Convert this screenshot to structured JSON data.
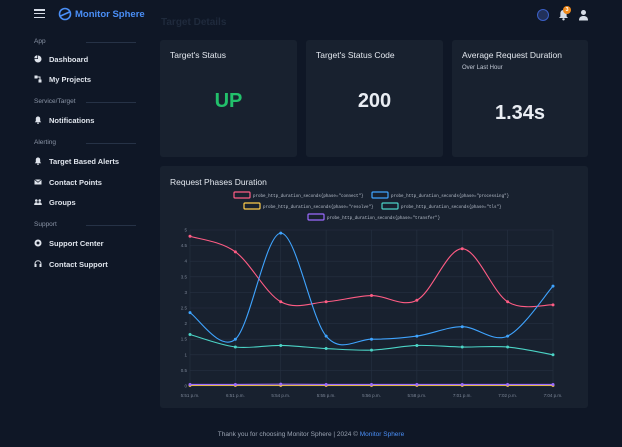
{
  "brand": {
    "name": "Monitor Sphere"
  },
  "header": {
    "notification_count": "3"
  },
  "page_title": "Target Details",
  "sidebar": {
    "sections": [
      {
        "label": "App",
        "items": [
          {
            "label": "Dashboard",
            "icon": "pie-chart-icon"
          },
          {
            "label": "My Projects",
            "icon": "projects-icon"
          }
        ]
      },
      {
        "label": "Service/Target",
        "items": [
          {
            "label": "Notifications",
            "icon": "bell-icon"
          }
        ]
      },
      {
        "label": "Alerting",
        "items": [
          {
            "label": "Target Based Alerts",
            "icon": "alert-bell-icon"
          },
          {
            "label": "Contact Points",
            "icon": "mail-icon"
          },
          {
            "label": "Groups",
            "icon": "users-icon"
          }
        ]
      },
      {
        "label": "Support",
        "items": [
          {
            "label": "Support Center",
            "icon": "support-icon"
          },
          {
            "label": "Contact Support",
            "icon": "headset-icon"
          }
        ]
      }
    ]
  },
  "cards": {
    "status": {
      "title": "Target's Status",
      "value": "UP",
      "color": "#22c06b"
    },
    "status_code": {
      "title": "Target's Status Code",
      "value": "200"
    },
    "avg_duration": {
      "title": "Average Request Duration",
      "subtitle": "Over Last Hour",
      "value": "1.34s"
    }
  },
  "chart": {
    "title": "Request Phases Duration"
  },
  "chart_data": {
    "type": "line",
    "x": [
      "5:51 p.m.",
      "6:51 p.m.",
      "5:54 p.m.",
      "5:55 p.m.",
      "5:56 p.m.",
      "5:58 p.m.",
      "7:01 p.m.",
      "7:02 p.m.",
      "7:04 p.m."
    ],
    "ylim": [
      0,
      5
    ],
    "yticks": [
      "0",
      "0.5",
      "1",
      "1.5",
      "2",
      "2.5",
      "3",
      "3.5",
      "4",
      "4.5",
      "5"
    ],
    "series": [
      {
        "name": "probe_http_duration_seconds{phase=\"connect\"}",
        "color": "#ff5c84",
        "values": [
          4.8,
          4.3,
          2.7,
          2.7,
          2.9,
          2.75,
          4.4,
          2.7,
          2.6
        ]
      },
      {
        "name": "probe_http_duration_seconds{phase=\"processing\"}",
        "color": "#3fa4ff",
        "values": [
          2.35,
          1.5,
          4.9,
          1.6,
          1.5,
          1.6,
          1.9,
          1.6,
          3.2
        ]
      },
      {
        "name": "probe_http_duration_seconds{phase=\"resolve\"}",
        "color": "#ffcd4a",
        "values": [
          0.02,
          0.02,
          0.02,
          0.02,
          0.02,
          0.02,
          0.02,
          0.02,
          0.02
        ]
      },
      {
        "name": "probe_http_duration_seconds{phase=\"tls\"}",
        "color": "#4bd4c6",
        "values": [
          1.65,
          1.25,
          1.3,
          1.2,
          1.15,
          1.3,
          1.25,
          1.25,
          1.0
        ]
      },
      {
        "name": "probe_http_duration_seconds{phase=\"transfer\"}",
        "color": "#9b6bff",
        "values": [
          0.05,
          0.05,
          0.06,
          0.05,
          0.05,
          0.05,
          0.05,
          0.05,
          0.05
        ]
      }
    ],
    "grid": true,
    "legend_position": "top"
  },
  "footer": {
    "text": "Thank you for choosing Monitor Sphere | 2024 © ",
    "link": "Monitor Sphere"
  }
}
